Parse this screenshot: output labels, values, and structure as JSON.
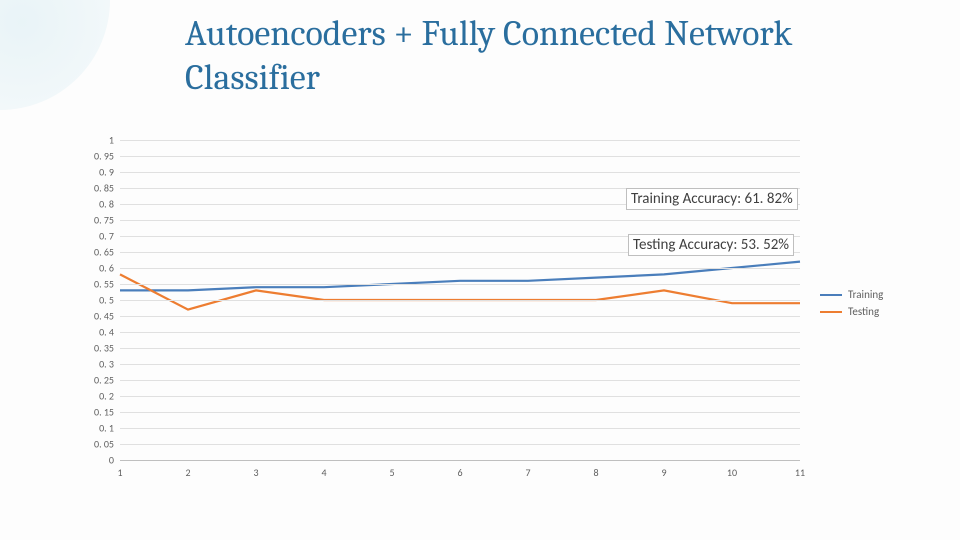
{
  "title": "Autoencoders + Fully Connected Network Classifier",
  "annotations": {
    "train_acc": "Training Accuracy: 61. 82%",
    "test_acc": "Testing Accuracy: 53. 52%"
  },
  "legend": {
    "training": "Training",
    "testing": "Testing"
  },
  "colors": {
    "training": "#4a7ebb",
    "testing": "#ed7d31"
  },
  "chart_data": {
    "type": "line",
    "xlabel": "",
    "ylabel": "",
    "x": [
      1,
      2,
      3,
      4,
      5,
      6,
      7,
      8,
      9,
      10,
      11
    ],
    "y_ticks": [
      0,
      0.05,
      0.1,
      0.15,
      0.2,
      0.25,
      0.3,
      0.35,
      0.4,
      0.45,
      0.5,
      0.55,
      0.6,
      0.65,
      0.7,
      0.75,
      0.8,
      0.85,
      0.9,
      0.95,
      1
    ],
    "y_tick_labels": [
      "0",
      "0. 05",
      "0. 1",
      "0. 15",
      "0. 2",
      "0. 25",
      "0. 3",
      "0. 35",
      "0. 4",
      "0. 45",
      "0. 5",
      "0. 55",
      "0. 6",
      "0. 65",
      "0. 7",
      "0. 75",
      "0. 8",
      "0. 85",
      "0. 9",
      "0. 95",
      "1"
    ],
    "ylim": [
      0,
      1
    ],
    "series": [
      {
        "name": "Training",
        "values": [
          0.53,
          0.53,
          0.54,
          0.54,
          0.55,
          0.56,
          0.56,
          0.57,
          0.58,
          0.6,
          0.62
        ]
      },
      {
        "name": "Testing",
        "values": [
          0.58,
          0.47,
          0.53,
          0.5,
          0.5,
          0.5,
          0.5,
          0.5,
          0.53,
          0.49,
          0.49
        ]
      }
    ]
  }
}
